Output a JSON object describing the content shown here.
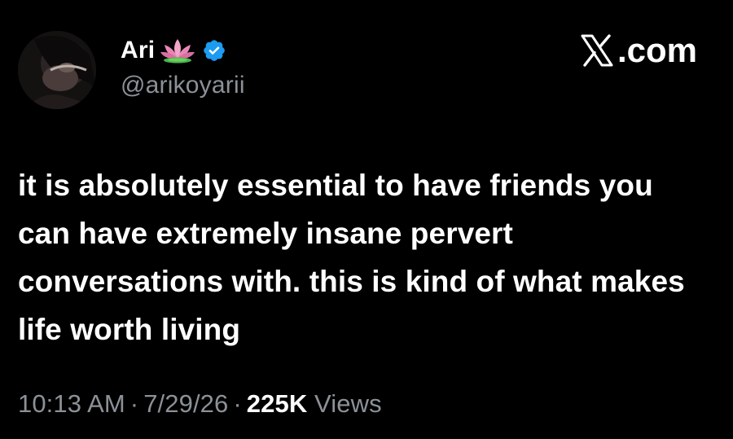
{
  "author": {
    "display_name": "Ari",
    "handle": "@arikoyarii",
    "emoji_icon": "lotus-icon",
    "verified_icon": "verified-badge-icon",
    "verified_color": "#1d9bf0"
  },
  "brand": {
    "label": ".com",
    "icon": "x-logo-icon"
  },
  "tweet": {
    "text": "it is absolutely essential to have friends you can have extremely insane pervert conversations with. this is kind of what makes life worth living"
  },
  "meta": {
    "time": "10:13 AM",
    "separator": "·",
    "date": "7/29/26",
    "views_count": "225K",
    "views_label": "Views"
  },
  "colors": {
    "background": "#000000",
    "text": "#ffffff",
    "muted": "#8b9197"
  }
}
